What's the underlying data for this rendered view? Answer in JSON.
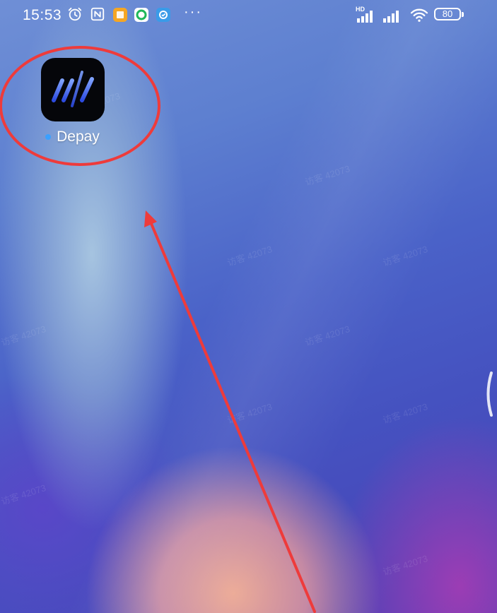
{
  "status_bar": {
    "time": "15:53",
    "hd_label": "HD",
    "battery_level": "80",
    "more_indicator": "···",
    "icons": [
      "alarm-icon",
      "nfc-icon",
      "notes-app-icon",
      "sync-app-icon",
      "security-app-icon",
      "signal-icon",
      "wifi-icon",
      "battery-icon"
    ]
  },
  "home": {
    "apps": [
      {
        "label": "Depay",
        "icon": "depay-app-icon",
        "new_indicator": true
      }
    ]
  },
  "colors": {
    "annotation": "#ee3b3b",
    "new_dot": "#3aa0ff",
    "icon_accent": "#3b6cff"
  },
  "watermark": "访客 42073"
}
